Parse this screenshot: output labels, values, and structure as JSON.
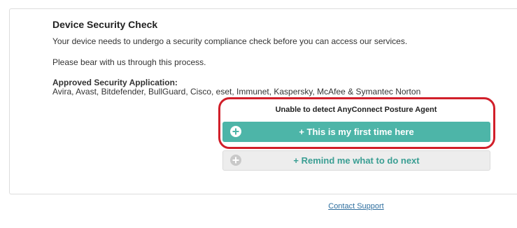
{
  "security_check": {
    "title": "Device Security Check",
    "description": "Your device needs to undergo a security compliance check before you can access our services.",
    "patience_note": "Please bear with us through this process.",
    "approved_heading": "Approved Security Application:",
    "approved_list": "Avira, Avast, Bitdefender, BullGuard, Cisco, eset, Immunet, Kaspersky, McAfee & Symantec Norton"
  },
  "agent_status": {
    "message": "Unable to detect AnyConnect Posture Agent"
  },
  "buttons": {
    "first_time_label": "+ This is my first time here",
    "remind_label": "+ Remind me what to do next"
  },
  "footer": {
    "contact_support": "Contact Support"
  },
  "colors": {
    "primary_button": "#4db5a8",
    "secondary_button": "#ededed",
    "highlight_border": "#d11f2a",
    "link": "#2f6f9f"
  },
  "icons": {
    "first_time_icon": "plus-circle-icon",
    "remind_icon": "plus-circle-icon"
  }
}
